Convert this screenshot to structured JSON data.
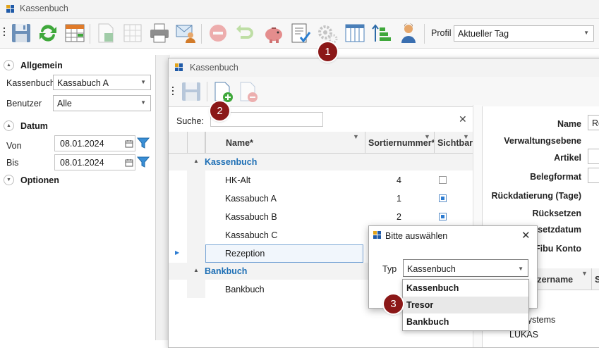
{
  "app": {
    "title": "Kassenbuch"
  },
  "toolbar": {
    "buttons": [
      "save-icon",
      "refresh-icon",
      "calendar-grid-icon",
      "export-excel-icon",
      "table-export-icon",
      "print-icon",
      "email-user-icon",
      "cancel-icon",
      "undo-icon",
      "piggy-bank-icon",
      "document-check-icon",
      "gear-icon",
      "columns-icon",
      "sort-icon",
      "user-icon"
    ],
    "profil_label": "Profil",
    "profil_value": "Aktueller Tag"
  },
  "left_panel": {
    "allgemein": {
      "title": "Allgemein",
      "kassenbuch_label": "Kassenbuch",
      "kassenbuch_value": "Kassabuch A",
      "benutzer_label": "Benutzer",
      "benutzer_value": "Alle"
    },
    "datum": {
      "title": "Datum",
      "von_label": "Von",
      "von_value": "08.01.2024",
      "bis_label": "Bis",
      "bis_value": "08.01.2024"
    },
    "optionen": {
      "title": "Optionen"
    }
  },
  "dialog": {
    "title": "Kassenbuch",
    "search_label": "Suche:",
    "search_value": "",
    "columns": {
      "name": "Name*",
      "sort": "Sortiernummer*",
      "visible": "Sichtbar"
    },
    "groups": [
      {
        "name": "Kassenbuch",
        "rows": [
          {
            "name": "HK-Alt",
            "sort": "4",
            "visible": false
          },
          {
            "name": "Kassabuch A",
            "sort": "1",
            "visible": true
          },
          {
            "name": "Kassabuch B",
            "sort": "2",
            "visible": true
          },
          {
            "name": "Kassabuch C",
            "sort": "",
            "visible": false
          },
          {
            "name": "Rezeption",
            "sort": "",
            "visible": false
          }
        ]
      },
      {
        "name": "Bankbuch",
        "rows": [
          {
            "name": "Bankbuch",
            "sort": "",
            "visible": false
          }
        ]
      }
    ],
    "details": {
      "name_label": "Name",
      "name_value": "Re",
      "verwaltungsebene_label": "Verwaltungsebene",
      "artikel_label": "Artikel",
      "belegformat_label": "Belegformat",
      "rueckdatierung_label": "Rückdatierung (Tage)",
      "ruecksetzen_label": "Rücksetzen",
      "ruecksetzdatum_label": "Rücksetzdatum",
      "fibu_label": "Fibu Konto",
      "sub_col_label": "Benutzername",
      "sub_col2_label": "S",
      "sub_row1": "a",
      "sub_row2": "meSystems",
      "sub_row3": "LUKAS"
    }
  },
  "popup": {
    "title": "Bitte auswählen",
    "typ_label": "Typ",
    "typ_value": "Kassenbuch",
    "options": [
      "Kassenbuch",
      "Tresor",
      "Bankbuch"
    ],
    "hovered_index": 1
  },
  "badges": [
    "1",
    "2",
    "3"
  ],
  "colors": {
    "badge": "#8b1818",
    "group_text": "#1e6fb5",
    "checkbox_on": "#2b7bd1",
    "filter_icon": "#3a8fd6"
  }
}
